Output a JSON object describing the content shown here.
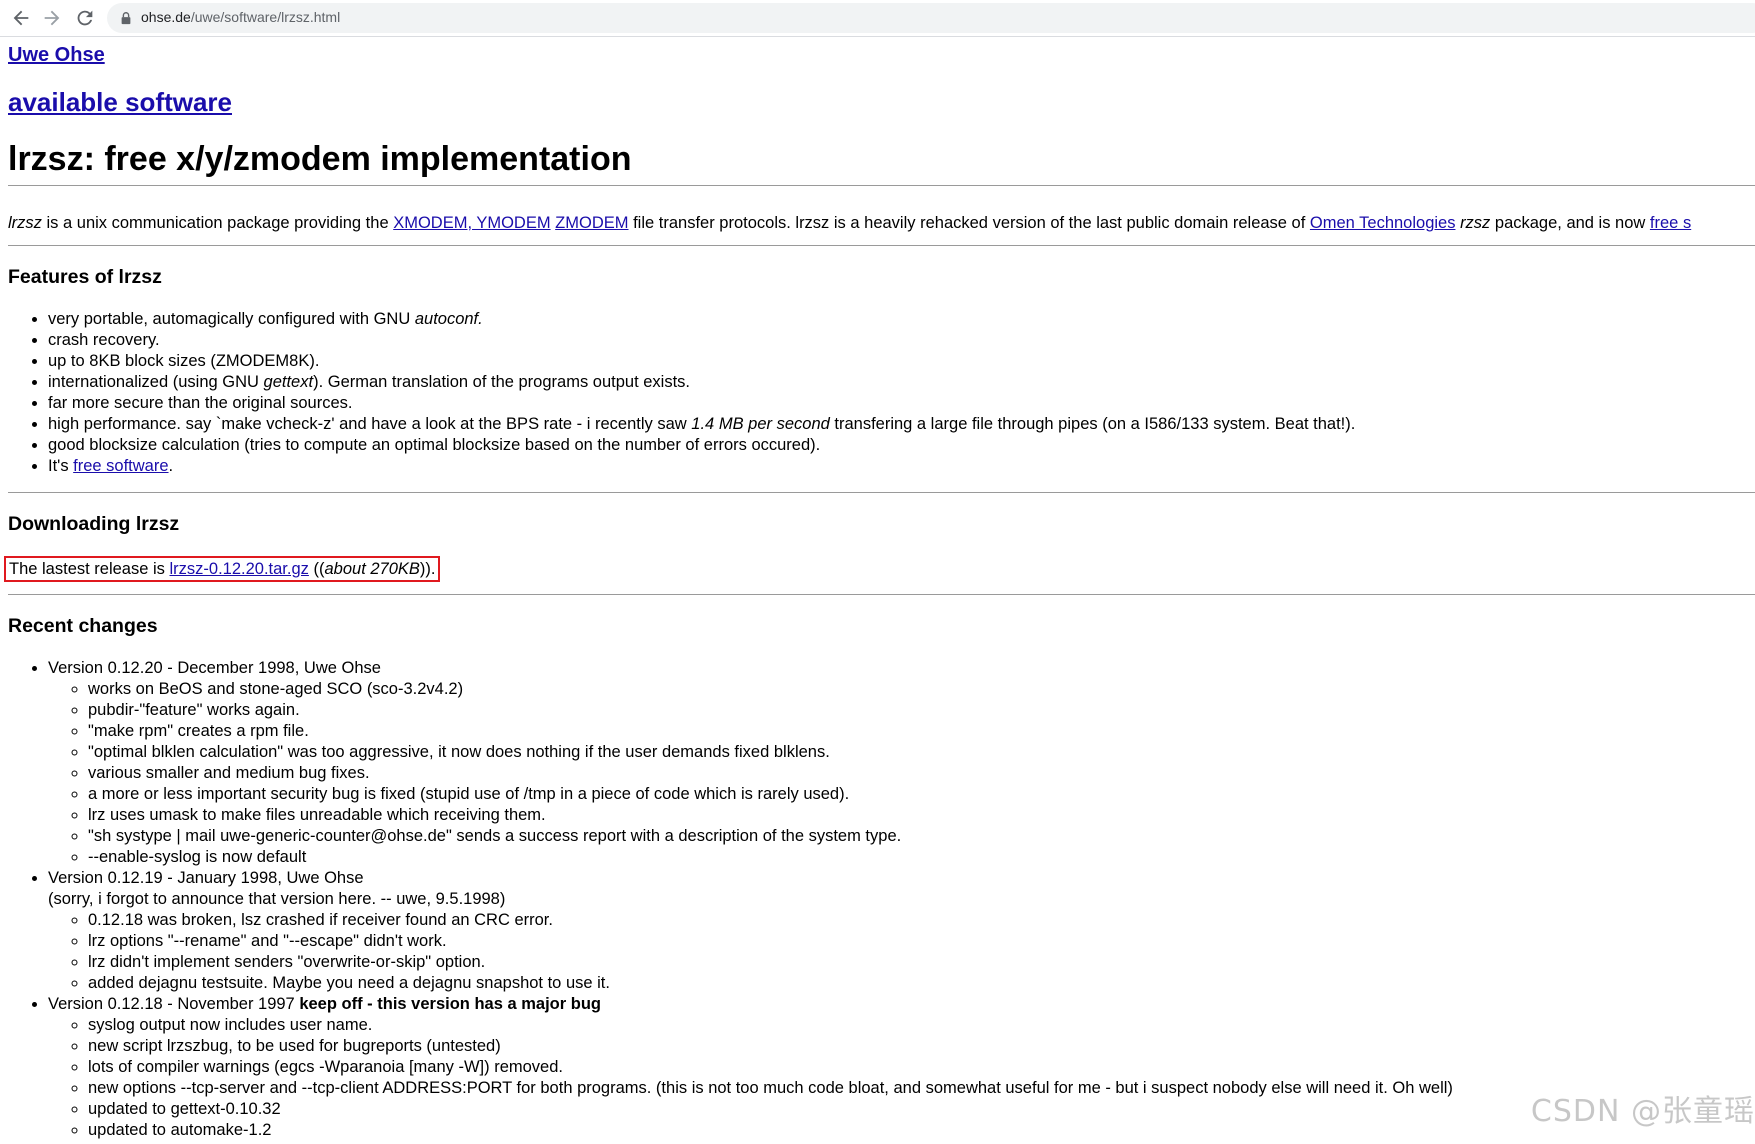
{
  "browser": {
    "back_icon": "arrow-left",
    "forward_icon": "arrow-right",
    "reload_icon": "reload",
    "lock_icon": "lock",
    "url_host": "ohse.de",
    "url_path": "/uwe/software/lrzsz.html"
  },
  "header": {
    "site_link": "Uwe Ohse",
    "software_link": "available software",
    "title": "lrzsz: free x/y/zmodem implementation"
  },
  "intro": {
    "lrzsz": "lrzsz",
    "text1": " is a unix communication package providing the ",
    "link_xy": "XMODEM, YMODEM",
    "sep": " ",
    "link_z": "ZMODEM",
    "text2": " file transfer protocols. lrzsz is a heavily rehacked version of the last public domain release of ",
    "link_omen": "Omen Technologies",
    "sep2": " ",
    "rzsz": "rzsz",
    "text3": " package, and is now ",
    "link_free": "free s"
  },
  "features": {
    "heading": "Features of lrzsz",
    "f1_text": "very portable, automagically configured with GNU ",
    "f1_em": "autoconf.",
    "f2": "crash recovery.",
    "f3": "up to 8KB block sizes (ZMODEM8K).",
    "f4_pre": "internationalized (using GNU ",
    "f4_em": "gettext",
    "f4_post": "). German translation of the programs output exists.",
    "f5": "far more secure than the original sources.",
    "f6_pre": "high performance. say `make vcheck-z' and have a look at the BPS rate - i recently saw ",
    "f6_em": "1.4 MB per second",
    "f6_post": " transfering a large file through pipes (on a I586/133 system. Beat that!).",
    "f7": "good blocksize calculation (tries to compute an optimal blocksize based on the number of errors occured).",
    "f8_pre": "It's ",
    "f8_link": "free software",
    "f8_post": "."
  },
  "download": {
    "heading": "Downloading lrzsz",
    "pre": "The lastest release is ",
    "link": "lrzsz-0.12.20.tar.gz",
    "mid": " ((",
    "em": "about 270KB",
    "post": "))."
  },
  "changes": {
    "heading": "Recent changes",
    "v1": {
      "title": "Version 0.12.20 - December 1998, Uwe Ohse",
      "items": [
        "works on BeOS and stone-aged SCO (sco-3.2v4.2)",
        "pubdir-\"feature\" works again.",
        "\"make rpm\" creates a rpm file.",
        "\"optimal blklen calculation\" was too aggressive, it now does nothing if the user demands fixed blklens.",
        "various smaller and medium bug fixes.",
        "a more or less important security bug is fixed (stupid use of /tmp in a piece of code which is rarely used).",
        "lrz uses umask to make files unreadable which receiving them.",
        "\"sh systype | mail uwe-generic-counter@ohse.de\" sends a success report with a description of the system type.",
        "--enable-syslog is now default"
      ]
    },
    "v2": {
      "title": "Version 0.12.19 - January 1998, Uwe Ohse",
      "note": "(sorry, i forgot to announce that version here. -- uwe, 9.5.1998)",
      "items": [
        "0.12.18 was broken, lsz crashed if receiver found an CRC error.",
        "lrz options \"--rename\" and \"--escape\" didn't work.",
        "lrz didn't implement senders \"overwrite-or-skip\" option.",
        "added dejagnu testsuite. Maybe you need a dejagnu snapshot to use it."
      ]
    },
    "v3": {
      "title": "Version 0.12.18 - November 1997 ",
      "warning": "keep off - this version has a major bug",
      "items": [
        "syslog output now includes user name.",
        "new script lrzszbug, to be used for bugreports (untested)",
        "lots of compiler warnings (egcs -Wparanoia [many -W]) removed.",
        "new options --tcp-server and --tcp-client ADDRESS:PORT for both programs. (this is not too much code bloat, and somewhat useful for me - but i suspect nobody else will need it. Oh well)",
        "updated to gettext-0.10.32",
        "updated to automake-1.2"
      ]
    }
  },
  "watermark": "CSDN @张童瑶"
}
